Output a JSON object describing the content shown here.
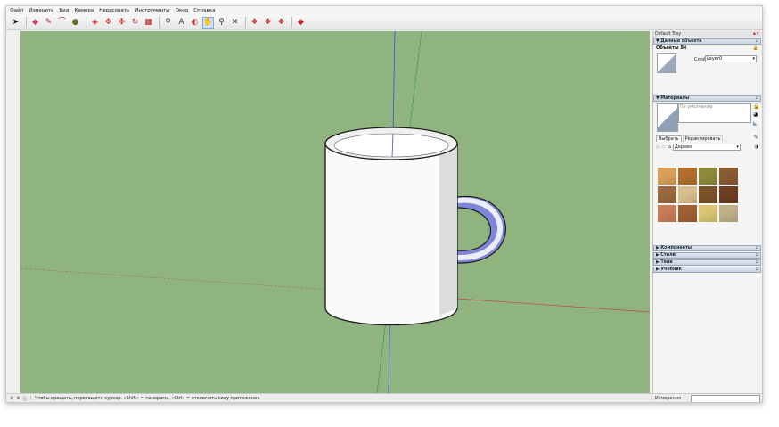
{
  "menu": [
    "Файл",
    "Изменить",
    "Вид",
    "Камера",
    "Нарисовать",
    "Инструменты",
    "Окно",
    "Справка"
  ],
  "toolbar": {
    "icons": [
      "select-icon",
      "eraser-icon",
      "pencil-icon",
      "arc-icon",
      "circle-icon",
      "pushpull-icon",
      "move-icon",
      "rotate-icon",
      "scale-icon",
      "paint-bucket-icon",
      "tape-measure-icon",
      "text-icon",
      "orbit-icon",
      "pan-icon",
      "zoom-icon",
      "zoom-extents-icon",
      "components-icon",
      "warehouse-icon",
      "extension-icon",
      "ruby-icon"
    ]
  },
  "tray": {
    "title": "Default Tray",
    "entity_info": {
      "header": "Данные объекта",
      "object_label": "Объекты 84",
      "layer_label": "Слой:",
      "layer_value": "Layer0"
    },
    "materials": {
      "header": "Материалы",
      "default_name": "По умолчанию",
      "tab_select": "Выбрать",
      "tab_edit": "Редактировать",
      "library": "Дерево",
      "swatch_colors": [
        "#d8a15a",
        "#b46e2c",
        "#8e8a3c",
        "#8a5a32",
        "#9a6a3e",
        "#d8c08a",
        "#7a5428",
        "#6e3e22",
        "#c87c58",
        "#a06030",
        "#d9c574",
        "#bfb08a"
      ]
    },
    "collapsed_panels": [
      "Компоненты",
      "Стили",
      "Тени",
      "Учебник"
    ]
  },
  "status": {
    "hint": "Чтобы вращать, перетащите курсор. «Shift» = панорама, «Ctrl» = отключить силу притяжения.",
    "measure_label": "Измерения"
  },
  "colors": {
    "viewport_bg": "#8fb47f",
    "axis_red": "#c24a3c",
    "axis_green": "#3f9a3f",
    "axis_blue": "#3a4fd0",
    "handle_fill": "#7f86d8"
  }
}
